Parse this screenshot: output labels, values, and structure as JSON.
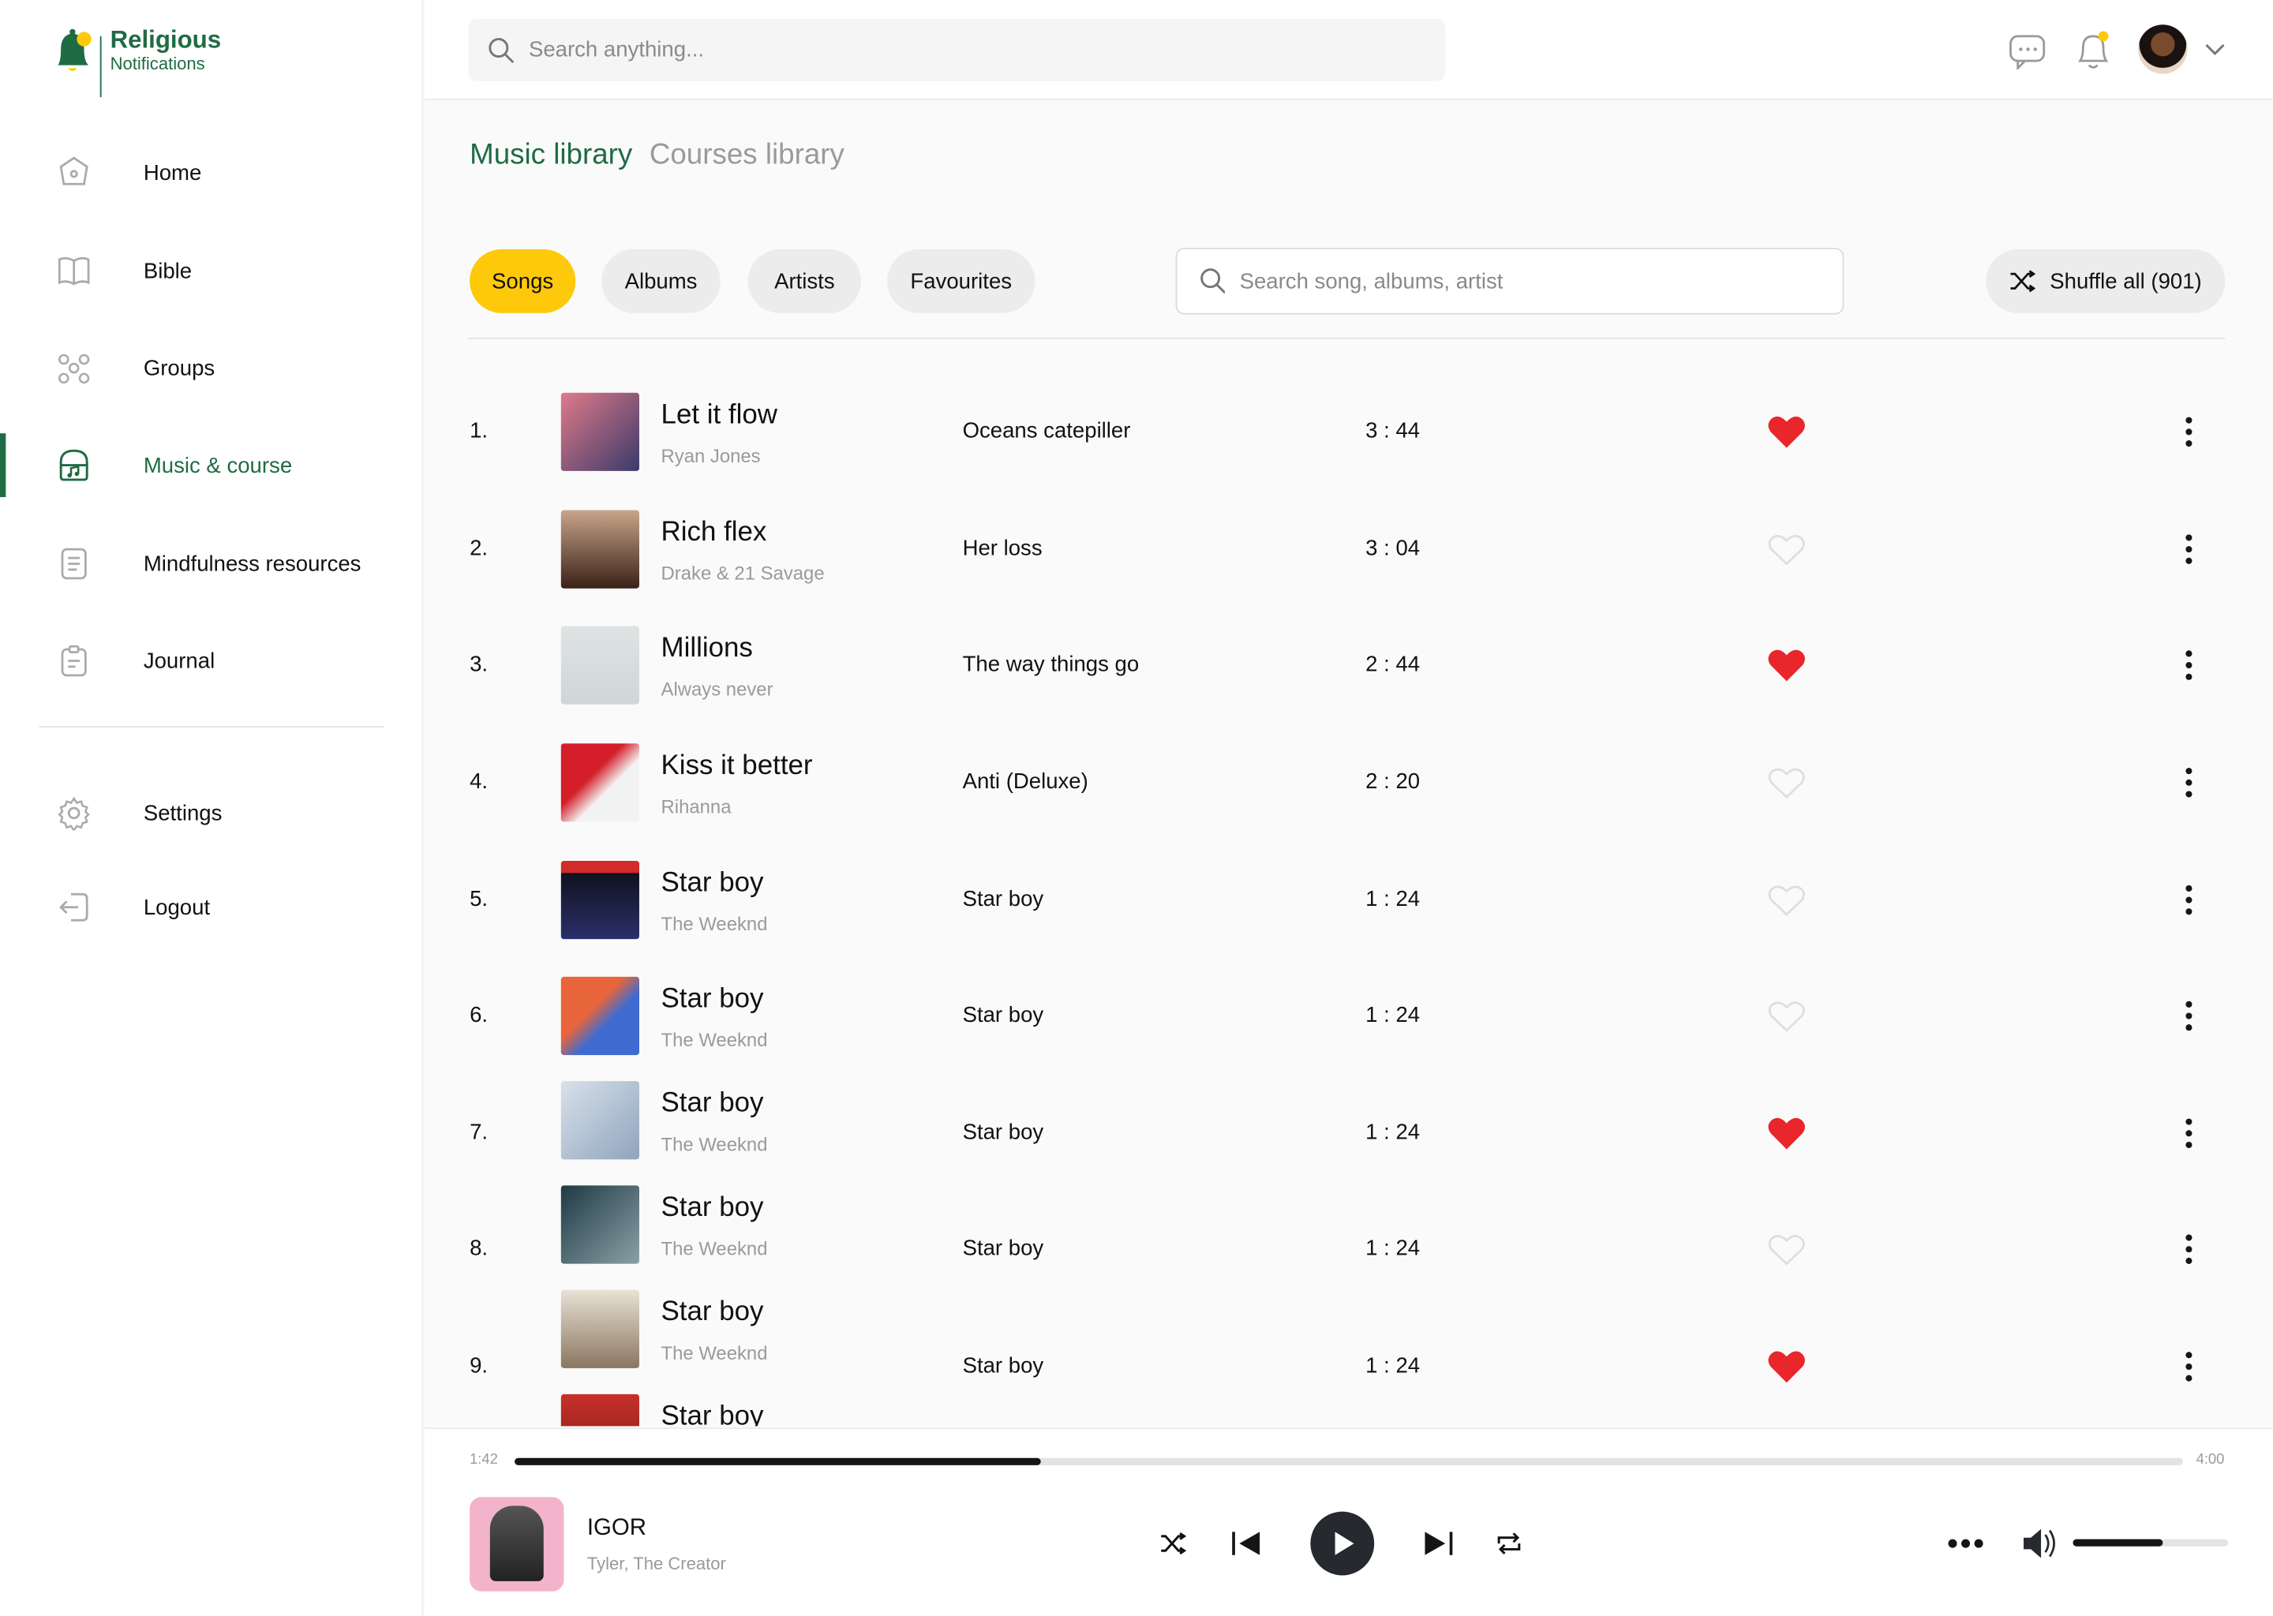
{
  "brand": {
    "name": "Religious",
    "tagline": "Notifications",
    "colors": {
      "green": "#1f6b43",
      "yellow": "#ffc90b"
    }
  },
  "sidebar": {
    "items": [
      {
        "label": "Home",
        "icon": "home-icon"
      },
      {
        "label": "Bible",
        "icon": "book-icon"
      },
      {
        "label": "Groups",
        "icon": "groups-icon"
      },
      {
        "label": "Music & course",
        "icon": "music-icon",
        "active": true
      },
      {
        "label": "Mindfulness resources",
        "icon": "document-icon"
      },
      {
        "label": "Journal",
        "icon": "clipboard-icon"
      }
    ],
    "bottom": [
      {
        "label": "Settings",
        "icon": "gear-icon"
      },
      {
        "label": "Logout",
        "icon": "logout-icon"
      }
    ]
  },
  "topbar": {
    "search_placeholder": "Search anything..."
  },
  "main": {
    "tabs": [
      {
        "label": "Music library",
        "active": true
      },
      {
        "label": "Courses library"
      }
    ],
    "filters": [
      {
        "label": "Songs",
        "active": true
      },
      {
        "label": "Albums"
      },
      {
        "label": "Artists"
      },
      {
        "label": "Favourites"
      }
    ],
    "search_placeholder": "Search song, albums, artist",
    "shuffle_label": "Shuffle all (901)",
    "songs": [
      {
        "num": "1.",
        "title": "Let it flow",
        "artist": "Ryan Jones",
        "album": "Oceans catepiller",
        "duration": "3 : 44",
        "favourite": true
      },
      {
        "num": "2.",
        "title": "Rich flex",
        "artist": "Drake & 21 Savage",
        "album": "Her loss",
        "duration": "3 : 04",
        "favourite": false
      },
      {
        "num": "3.",
        "title": "Millions",
        "artist": "Always never",
        "album": "The way things go",
        "duration": "2 : 44",
        "favourite": true
      },
      {
        "num": "4.",
        "title": "Kiss it better",
        "artist": "Rihanna",
        "album": "Anti (Deluxe)",
        "duration": "2 : 20",
        "favourite": false
      },
      {
        "num": "5.",
        "title": "Star boy",
        "artist": "The Weeknd",
        "album": "Star boy",
        "duration": "1 : 24",
        "favourite": false
      },
      {
        "num": "6.",
        "title": "Star boy",
        "artist": "The Weeknd",
        "album": "Star boy",
        "duration": "1 : 24",
        "favourite": false
      },
      {
        "num": "7.",
        "title": "Star boy",
        "artist": "The Weeknd",
        "album": "Star boy",
        "duration": "1 : 24",
        "favourite": true
      },
      {
        "num": "8.",
        "title": "Star boy",
        "artist": "The Weeknd",
        "album": "Star boy",
        "duration": "1 : 24",
        "favourite": false
      },
      {
        "num": "9.",
        "title": "Star boy",
        "artist": "The Weeknd",
        "album": "Star boy",
        "duration": "1 : 24",
        "favourite": true
      },
      {
        "num": "",
        "title": "Star boy",
        "artist": "",
        "album": "",
        "duration": "",
        "favourite": false
      }
    ]
  },
  "player": {
    "title": "IGOR",
    "artist": "Tyler, The Creator",
    "elapsed": "1:42",
    "total": "4:00",
    "progress": 0.315,
    "volume": 0.58
  }
}
